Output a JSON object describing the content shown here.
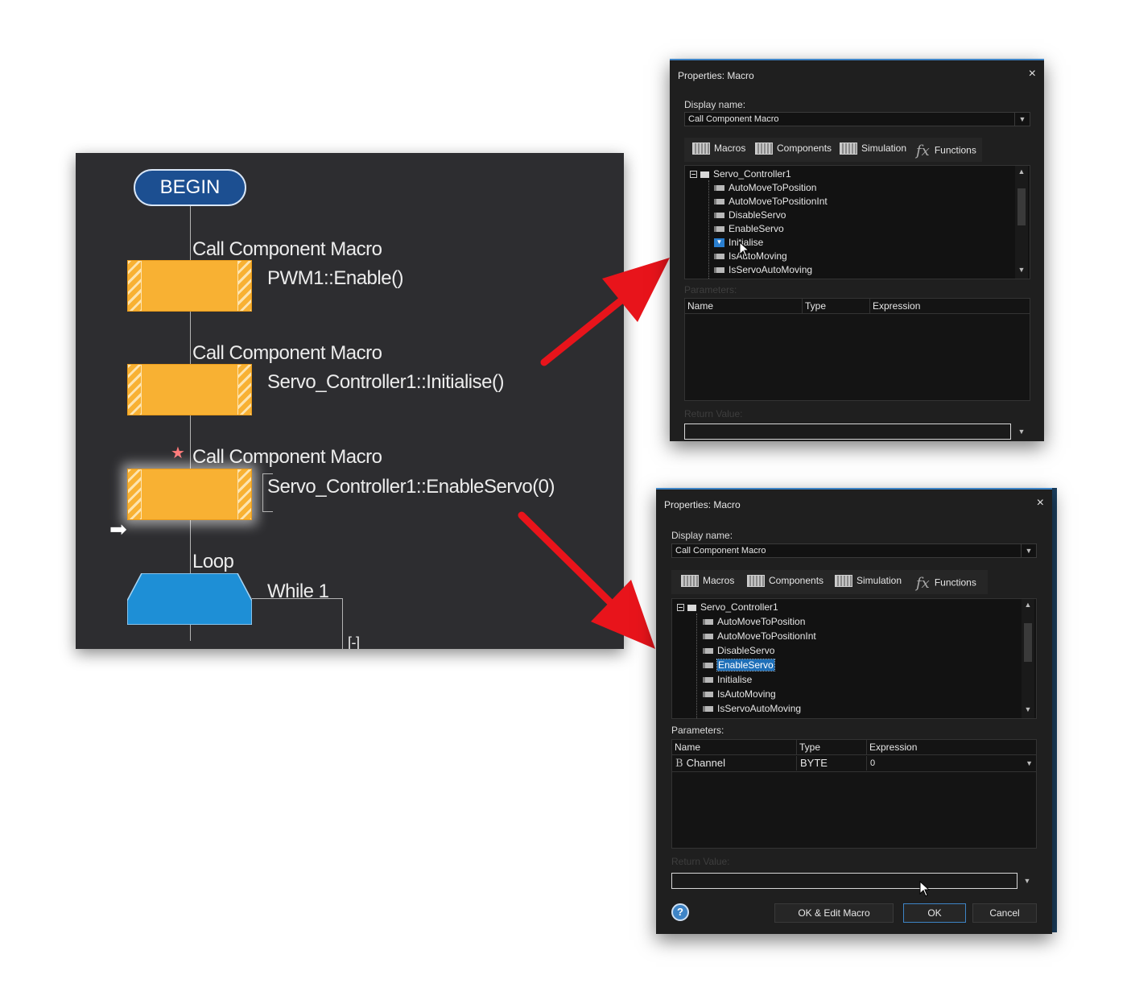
{
  "flowchart": {
    "begin_label": "BEGIN",
    "blocks": [
      {
        "caption": "Call Component Macro",
        "call": "PWM1::Enable()"
      },
      {
        "caption": "Call Component Macro",
        "call": "Servo_Controller1::Initialise()"
      },
      {
        "caption": "Call Component Macro",
        "call": "Servo_Controller1::EnableServo(0)"
      }
    ],
    "loop": {
      "caption": "Loop",
      "condition": "While 1",
      "collapse": "[-]"
    },
    "colors": {
      "background": "#2d2d30",
      "macro": "#f8b133",
      "loop": "#1e8fd6",
      "begin": "#1c4f91"
    }
  },
  "dialog_top": {
    "title": "Properties: Macro",
    "close": "×",
    "display_name_label": "Display name:",
    "display_name_value": "Call Component Macro",
    "tabs": [
      "Macros",
      "Components",
      "Simulation",
      "Functions"
    ],
    "tree_root": "Servo_Controller1",
    "tree_items": [
      "AutoMoveToPosition",
      "AutoMoveToPositionInt",
      "DisableServo",
      "EnableServo",
      "Initialise",
      "IsAutoMoving",
      "IsServoAutoMoving"
    ],
    "hover_item": "Initialise",
    "parameters_label": "Parameters:",
    "columns": [
      "Name",
      "Type",
      "Expression"
    ],
    "return_label": "Return Value:"
  },
  "dialog_bottom": {
    "title": "Properties: Macro",
    "close": "×",
    "display_name_label": "Display name:",
    "display_name_value": "Call Component Macro",
    "tabs": [
      "Macros",
      "Components",
      "Simulation",
      "Functions"
    ],
    "tree_root": "Servo_Controller1",
    "tree_items": [
      "AutoMoveToPosition",
      "AutoMoveToPositionInt",
      "DisableServo",
      "EnableServo",
      "Initialise",
      "IsAutoMoving",
      "IsServoAutoMoving"
    ],
    "selected_item": "EnableServo",
    "parameters_label": "Parameters:",
    "columns": [
      "Name",
      "Type",
      "Expression"
    ],
    "params": [
      {
        "icon": "B",
        "name": "Channel",
        "type": "BYTE",
        "expression": "0"
      }
    ],
    "return_label": "Return Value:",
    "buttons": {
      "ok_edit": "OK & Edit Macro",
      "ok": "OK",
      "cancel": "Cancel",
      "help": "?"
    }
  }
}
